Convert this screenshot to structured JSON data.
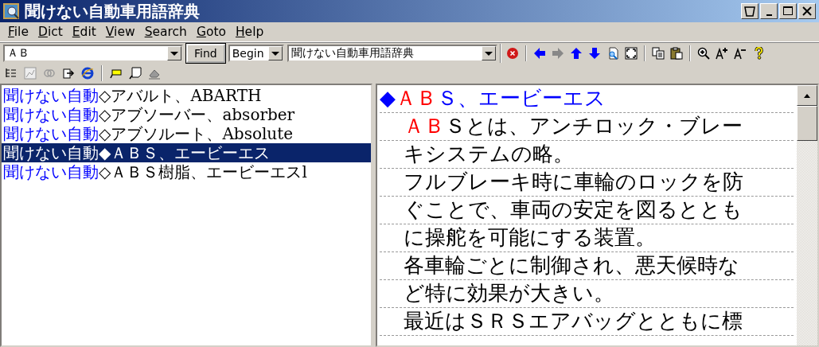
{
  "window": {
    "title": "聞けない自動車用語辞典"
  },
  "menu": [
    "File",
    "Dict",
    "Edit",
    "View",
    "Search",
    "Goto",
    "Help"
  ],
  "search": {
    "value": "ＡＢ",
    "find_button": "Find",
    "mode": "Begin",
    "dictionary": "聞けない自動車用語辞典"
  },
  "nav_buttons": [
    {
      "kind": "back",
      "disabled": false
    },
    {
      "kind": "forward",
      "disabled": true
    },
    {
      "kind": "up",
      "disabled": false
    },
    {
      "kind": "down",
      "disabled": false
    }
  ],
  "word_list": [
    {
      "prefix": "聞けない自動",
      "marker": "◇",
      "text": "アバルト、ABARTH",
      "selected": false
    },
    {
      "prefix": "聞けない自動",
      "marker": "◇",
      "text": "アブソーバー、absorber",
      "selected": false
    },
    {
      "prefix": "聞けない自動",
      "marker": "◇",
      "text": "アブソルート、Absolute",
      "selected": false
    },
    {
      "prefix": "聞けない自動",
      "marker": "◆",
      "text": "ＡＢＳ、エービーエス",
      "selected": true
    },
    {
      "prefix": "聞けない自動",
      "marker": "◇",
      "text": "ＡＢＳ樹脂、エービーエスl",
      "selected": false
    }
  ],
  "entry": {
    "lines": [
      {
        "kind": "heading",
        "segments": [
          {
            "text": "◆",
            "color": "#0000ff"
          },
          {
            "text": "ＡＢ",
            "color": "#ff0000"
          },
          {
            "text": "Ｓ、エービーエス",
            "color": "#0000ff"
          }
        ]
      },
      {
        "kind": "body",
        "segments": [
          {
            "text": "ＡＢ",
            "color": "#ff0000"
          },
          {
            "text": "Ｓとは、アンチロック・ブレー",
            "color": "#000000"
          }
        ]
      },
      {
        "kind": "body",
        "segments": [
          {
            "text": "キシステムの略。",
            "color": "#000000"
          }
        ]
      },
      {
        "kind": "body",
        "segments": [
          {
            "text": "フルブレーキ時に車輪のロックを防",
            "color": "#000000"
          }
        ]
      },
      {
        "kind": "body",
        "segments": [
          {
            "text": "ぐことで、車両の安定を図るととも",
            "color": "#000000"
          }
        ]
      },
      {
        "kind": "body",
        "segments": [
          {
            "text": "に操舵を可能にする装置。",
            "color": "#000000"
          }
        ]
      },
      {
        "kind": "body",
        "segments": [
          {
            "text": "各車輪ごとに制御され、悪天候時な",
            "color": "#000000"
          }
        ]
      },
      {
        "kind": "body",
        "segments": [
          {
            "text": "ど特に効果が大きい。",
            "color": "#000000"
          }
        ]
      },
      {
        "kind": "body",
        "segments": [
          {
            "text": "最近はＳＲＳエアバッグとともに標",
            "color": "#000000"
          }
        ]
      }
    ]
  }
}
